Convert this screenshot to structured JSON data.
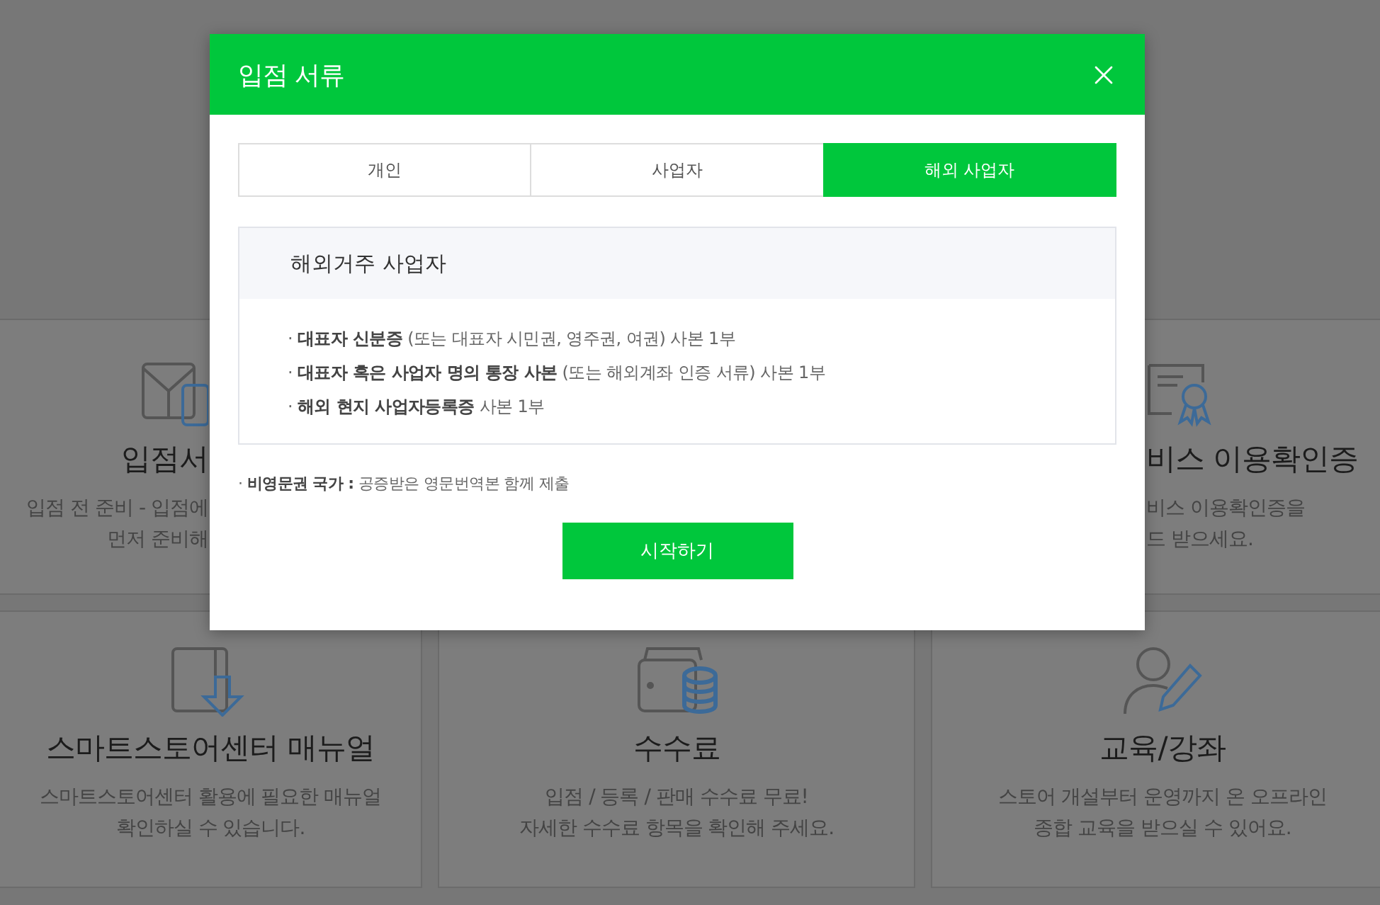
{
  "background": {
    "top_cards": [
      {
        "title": "입점서",
        "description": [
          "입점 전 준비 - 입점에",
          "먼저 준비해"
        ]
      },
      {
        "title": "비스 이용확인증",
        "description": [
          "비스 이용확인증을",
          "드 받으세요."
        ]
      }
    ],
    "bottom_cards": [
      {
        "title": "스마트스토어센터 매뉴얼",
        "description": [
          "스마트스토어센터 활용에 필요한 매뉴얼",
          "확인하실 수 있습니다."
        ]
      },
      {
        "title": "수수료",
        "description": [
          "입점 / 등록 / 판매 수수료 무료!",
          "자세한 수수료 항목을 확인해 주세요."
        ]
      },
      {
        "title": "교육/강좌",
        "description": [
          "스토어 개설부터 운영까지 온 오프라인",
          "종합 교육을 받으실 수 있어요."
        ]
      }
    ]
  },
  "modal": {
    "title": "입점 서류",
    "tabs": [
      {
        "label": "개인",
        "selected": false
      },
      {
        "label": "사업자",
        "selected": false
      },
      {
        "label": "해외 사업자",
        "selected": true
      }
    ],
    "section": {
      "heading": "해외거주 사업자",
      "items": [
        "· **대표자 신분증** (또는 대표자 시민권, 영주권, 여권) 사본 1부",
        "· **대표자 혹은 사업자 명의 통장 사본** (또는 해외계좌 인증 서류) 사본 1부",
        "· **해외 현지 사업자등록증** 사본 1부"
      ]
    },
    "note": "· **비영문권 국가 :** 공증받은 영문번역본 함께 제출",
    "start_button": "시작하기"
  }
}
